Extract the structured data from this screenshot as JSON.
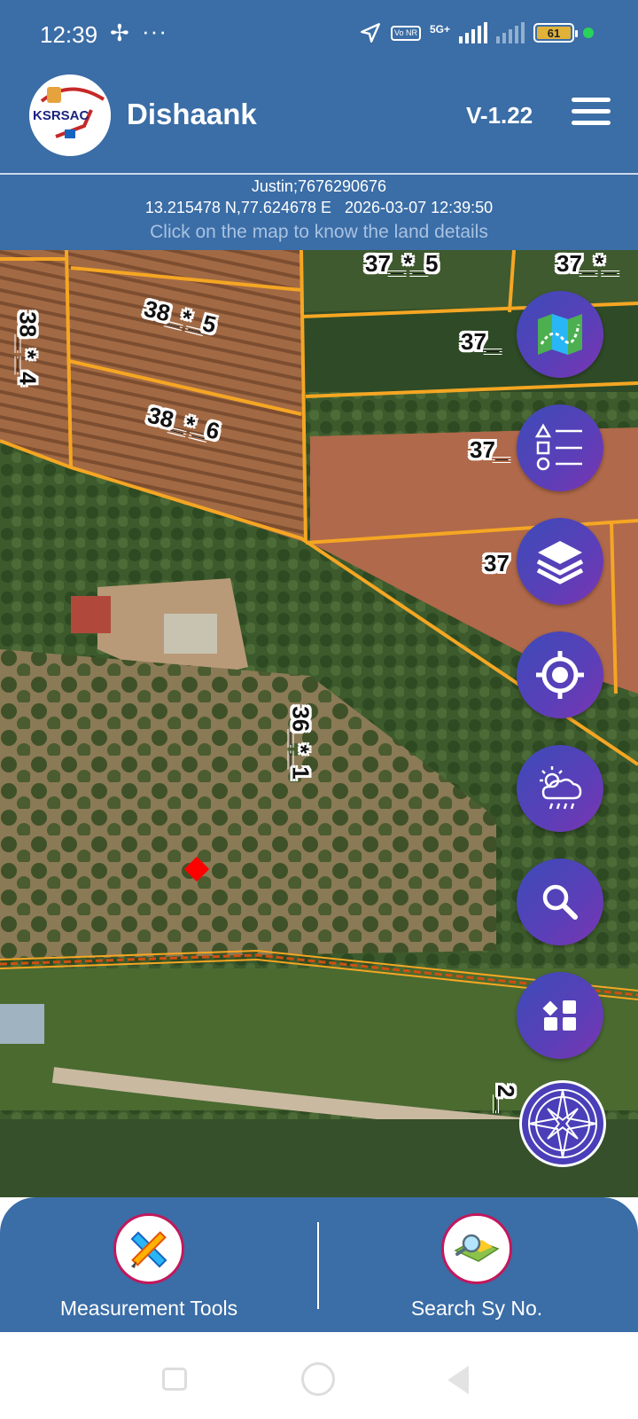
{
  "status_bar": {
    "time": "12:39",
    "network_5g": "5G+",
    "volte": "Vo NR",
    "battery": "61",
    "colors": {
      "battery": "#e0b23a",
      "active_dot": "#29d35a"
    },
    "icons": [
      "fan-icon",
      "more-dots-icon",
      "location-arrow-icon",
      "signal-icon",
      "battery-icon"
    ]
  },
  "header": {
    "logo_text": "KSRSAC",
    "title": "Dishaank",
    "version": "V-1.22",
    "bg_color": "#3b6da6"
  },
  "info": {
    "user": "Justin;7676290676",
    "coordinates": "13.215478 N,77.624678 E",
    "datetime": "2026-03-07 12:39:50",
    "hint": "Click on the map to know the land details"
  },
  "map": {
    "plots": {
      "p1": "37_*_5",
      "p2": "37_*_",
      "p3": "38_*_5",
      "p4": "38_*_4",
      "p5": "37_",
      "p6": "38_*_6",
      "p7": "37_",
      "p8": "37",
      "p9": "36_*_1",
      "p10": "2_"
    },
    "boundary_color": "#f5a623",
    "marker_color": "#ff0000"
  },
  "fabs": [
    {
      "name": "map-layer-button",
      "icon": "map-icon"
    },
    {
      "name": "legend-button",
      "icon": "legend-list-icon"
    },
    {
      "name": "layers-button",
      "icon": "layers-icon"
    },
    {
      "name": "locate-button",
      "icon": "crosshair-icon"
    },
    {
      "name": "weather-button",
      "icon": "weather-icon"
    },
    {
      "name": "search-button",
      "icon": "search-icon"
    },
    {
      "name": "apps-button",
      "icon": "grid-icon"
    },
    {
      "name": "compass-button",
      "icon": "compass-icon"
    }
  ],
  "bottom": {
    "measurement_label": "Measurement Tools",
    "search_label": "Search Sy No."
  }
}
